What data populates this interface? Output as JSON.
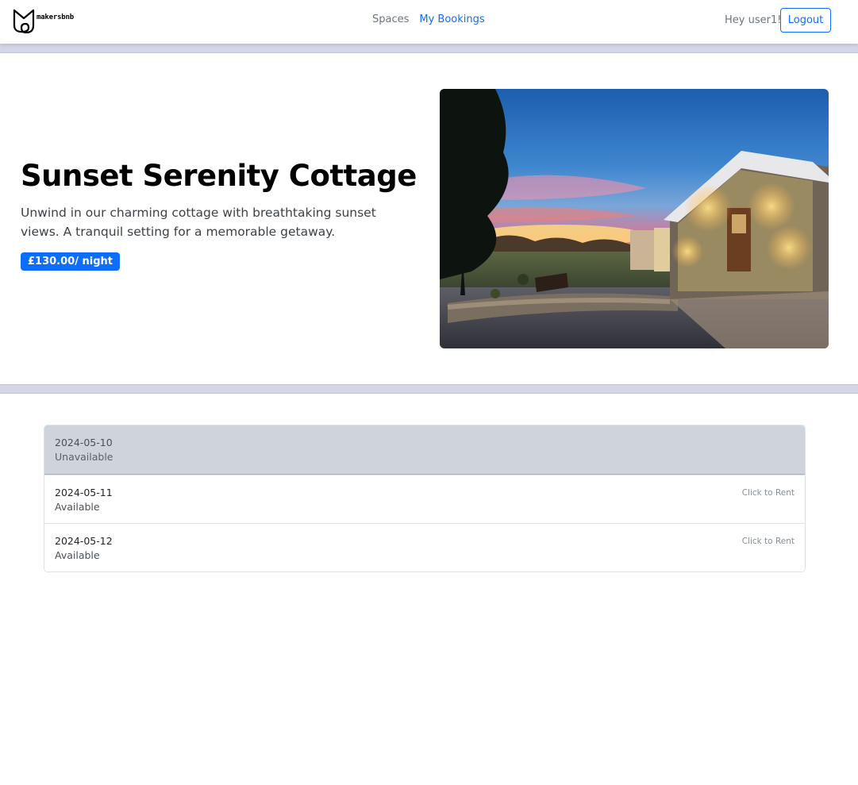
{
  "brand": {
    "name": "makersbnb",
    "logo_icon": "makersbnb-logo-icon"
  },
  "nav": {
    "links": [
      {
        "label": "Spaces",
        "active": false
      },
      {
        "label": "My Bookings",
        "active": true
      }
    ],
    "greeting": "Hey user1!",
    "logout_label": "Logout"
  },
  "space": {
    "title": "Sunset Serenity Cottage",
    "description": "Unwind in our charming cottage with breathtaking sunset views. A tranquil setting for a memorable getaway.",
    "price_label": "£130.00/ night"
  },
  "availability": [
    {
      "date": "2024-05-10",
      "status": "Unavailable",
      "action": ""
    },
    {
      "date": "2024-05-11",
      "status": "Available",
      "action": "Click to Rent"
    },
    {
      "date": "2024-05-12",
      "status": "Available",
      "action": "Click to Rent"
    }
  ],
  "colors": {
    "primary": "#0d6efd",
    "band": "#d5d5e8",
    "unavailable_bg": "#cfd4db"
  }
}
